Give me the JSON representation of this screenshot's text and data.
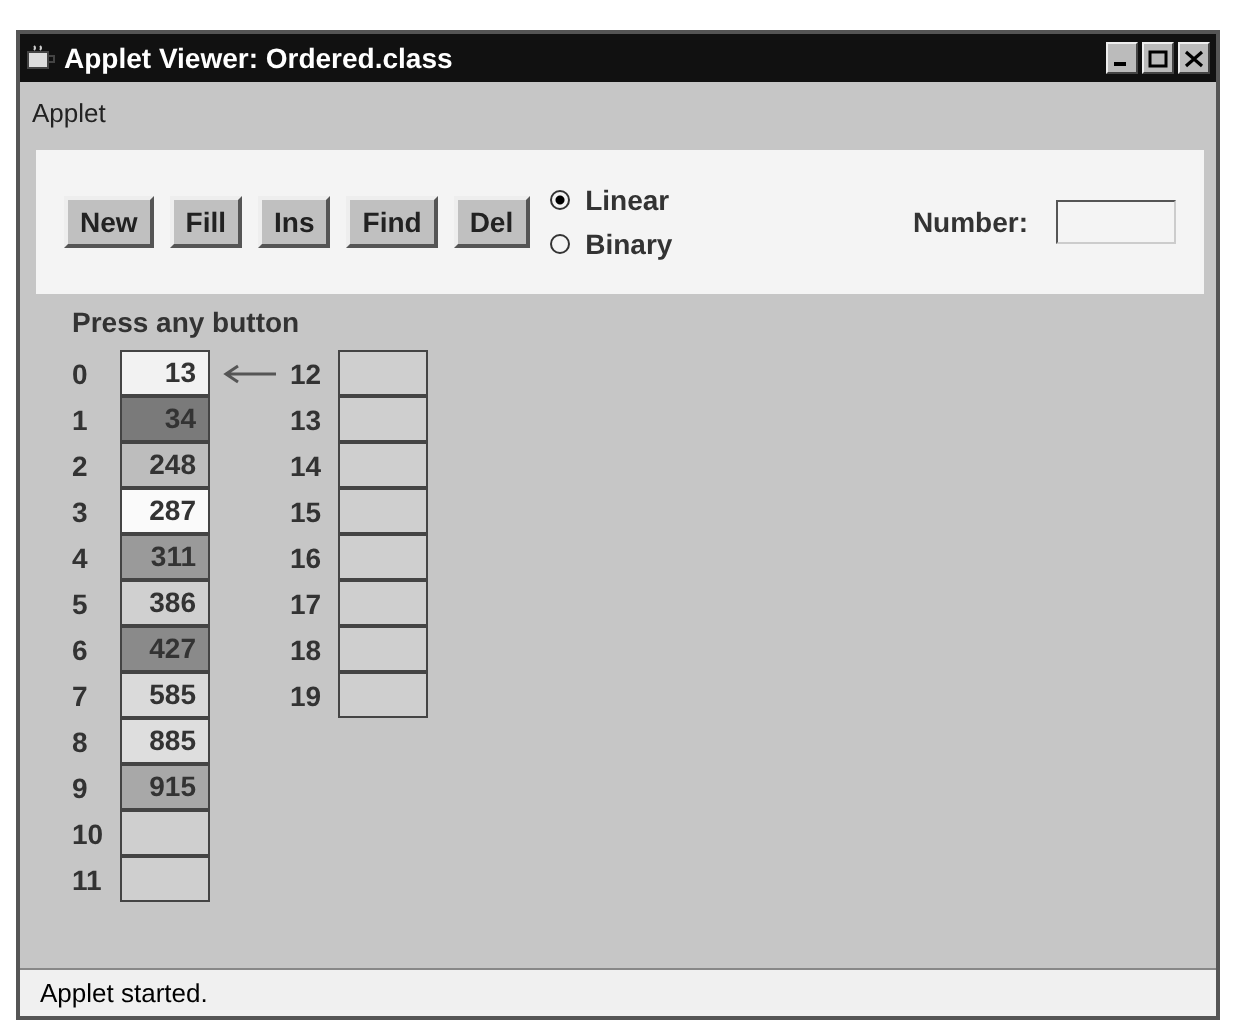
{
  "window": {
    "title": "Applet Viewer: Ordered.class"
  },
  "menu": [
    "Applet"
  ],
  "buttons": [
    "New",
    "Fill",
    "Ins",
    "Find",
    "Del"
  ],
  "search_type": [
    {
      "label": "Linear",
      "selected": true
    },
    {
      "label": "Binary",
      "selected": false
    }
  ],
  "number_field": {
    "label": "Number:"
  },
  "message": "Press any button",
  "cells": [
    {
      "index": "0",
      "value": "13",
      "color": "#f2f2f2",
      "pointed": true
    },
    {
      "index": "1",
      "value": "34",
      "color": "#7a7a7a",
      "pointed": false
    },
    {
      "index": "2",
      "value": "248",
      "color": "#bdbdbd",
      "pointed": false
    },
    {
      "index": "3",
      "value": "287",
      "color": "#fafafa",
      "pointed": false
    },
    {
      "index": "4",
      "value": "311",
      "color": "#9a9a9a",
      "pointed": false
    },
    {
      "index": "5",
      "value": "386",
      "color": "#d0d0d0",
      "pointed": false
    },
    {
      "index": "6",
      "value": "427",
      "color": "#8a8a8a",
      "pointed": false
    },
    {
      "index": "7",
      "value": "585",
      "color": "#dadada",
      "pointed": false
    },
    {
      "index": "8",
      "value": "885",
      "color": "#dedede",
      "pointed": false
    },
    {
      "index": "9",
      "value": "915",
      "color": "#a8a8a8",
      "pointed": false
    },
    {
      "index": "10",
      "pointed": false
    },
    {
      "index": "11",
      "pointed": false
    },
    {
      "index": "12",
      "pointed": false
    },
    {
      "index": "13",
      "pointed": false
    },
    {
      "index": "14",
      "pointed": false
    },
    {
      "index": "15",
      "pointed": false
    },
    {
      "index": "16",
      "pointed": false
    },
    {
      "index": "17",
      "pointed": false
    },
    {
      "index": "18",
      "pointed": false
    },
    {
      "index": "19",
      "pointed": false
    }
  ],
  "status_bar": "Applet started."
}
